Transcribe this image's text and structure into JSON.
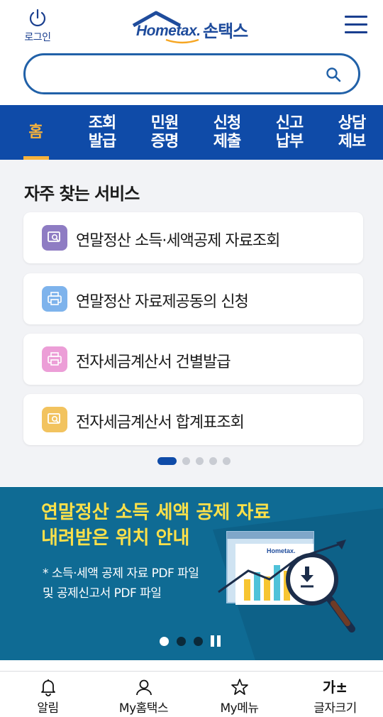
{
  "header": {
    "login_label": "로그인",
    "logo_en": "Hometax.",
    "logo_ko": "손택스",
    "search": {
      "value": "",
      "placeholder": ""
    }
  },
  "nav": {
    "items": [
      {
        "label": "홈",
        "active": true
      },
      {
        "label": "조회\n발급"
      },
      {
        "label": "민원\n증명"
      },
      {
        "label": "신청\n제출"
      },
      {
        "label": "신고\n납부"
      },
      {
        "label": "상담\n제보"
      }
    ]
  },
  "services": {
    "title": "자주 찾는 서비스",
    "items": [
      {
        "label": "연말정산 소득·세액공제 자료조회",
        "icon": "search-document-icon",
        "color": "#8e7cc3"
      },
      {
        "label": "연말정산 자료제공동의 신청",
        "icon": "printer-icon",
        "color": "#7eb3ec"
      },
      {
        "label": "전자세금계산서 건별발급",
        "icon": "printer-icon",
        "color": "#ec9ed7"
      },
      {
        "label": "전자세금계산서 합계표조회",
        "icon": "search-document-icon",
        "color": "#f2c35f"
      }
    ],
    "pager": {
      "count": 5,
      "active": 1
    }
  },
  "banner": {
    "title": "연말정산 소득 세액 공제 자료\n내려받은 위치 안내",
    "subtitle": "* 소득·세액 공제 자료 PDF 파일\n  및 공제신고서 PDF 파일",
    "illustration_logo": "Hometax.",
    "pager": {
      "count": 3,
      "active": 1
    }
  },
  "tabbar": {
    "items": [
      {
        "label": "알림",
        "icon": "bell-icon"
      },
      {
        "label": "My홈택스",
        "icon": "person-icon"
      },
      {
        "label": "My메뉴",
        "icon": "star-icon"
      },
      {
        "label": "글자크기",
        "icon": "font-size-icon",
        "glyph": "가±"
      }
    ]
  },
  "colors": {
    "brand_blue": "#0f4ba8",
    "accent_orange": "#f6b23c",
    "banner_bg": "#0f6b94",
    "banner_title": "#fbe04a"
  }
}
